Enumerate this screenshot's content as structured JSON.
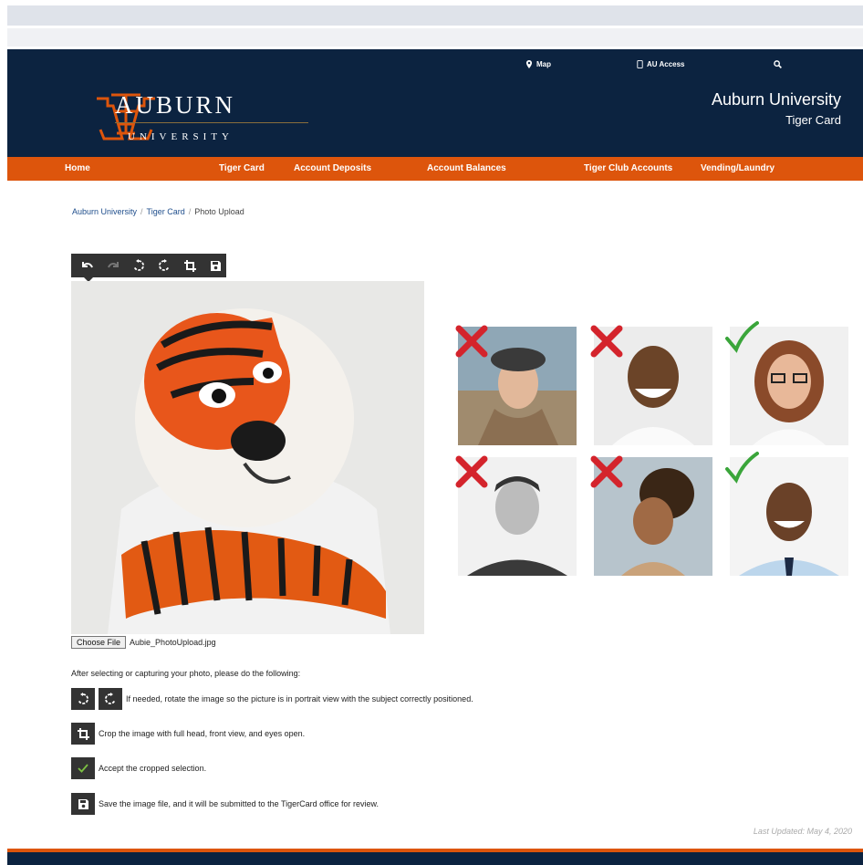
{
  "utility_links": [
    {
      "label": "Map",
      "icon": "map-pin-icon"
    },
    {
      "label": "AU Access",
      "icon": "mobile-icon"
    },
    {
      "label": "",
      "icon": "search-icon"
    }
  ],
  "logo": {
    "word": "AUBURN",
    "sub": "UNIVERSITY"
  },
  "site_title": {
    "line1": "Auburn University",
    "line2": "Tiger Card"
  },
  "nav": [
    {
      "label": "Home"
    },
    {
      "label": "Tiger Card"
    },
    {
      "label": "Account Deposits"
    },
    {
      "label": "Account Balances"
    },
    {
      "label": "Tiger Club Accounts"
    },
    {
      "label": "Vending/Laundry"
    }
  ],
  "breadcrumb": [
    {
      "label": "Auburn University"
    },
    {
      "label": "Tiger Card"
    },
    {
      "label": "Photo Upload"
    }
  ],
  "toolbar_icons": [
    "undo-icon",
    "redo-icon",
    "rotate-left-icon",
    "rotate-right-icon",
    "crop-icon",
    "save-icon"
  ],
  "file_input": {
    "button_label": "Choose File",
    "file_name": "Aubie_PhotoUpload.jpg"
  },
  "examples": [
    {
      "status": "rejected",
      "icon": "x-mark-icon"
    },
    {
      "status": "rejected",
      "icon": "x-mark-icon"
    },
    {
      "status": "accepted",
      "icon": "check-mark-icon"
    },
    {
      "status": "rejected",
      "icon": "x-mark-icon"
    },
    {
      "status": "rejected",
      "icon": "x-mark-icon"
    },
    {
      "status": "accepted",
      "icon": "check-mark-icon"
    }
  ],
  "instructions": {
    "lead": "After selecting or capturing your photo, please do the following:",
    "steps": [
      {
        "text": "If needed, rotate the image so the picture is in portrait view with the subject correctly positioned."
      },
      {
        "text": "Crop the image with full head, front view, and eyes open."
      },
      {
        "text": "Accept the cropped selection."
      },
      {
        "text": "Save the image file, and it will be submitted to the TigerCard office for review."
      }
    ]
  },
  "last_updated": "Last Updated: May 4, 2020",
  "colors": {
    "navy": "#0c2340",
    "orange": "#dd550c",
    "reject": "#d4242c",
    "accept": "#3aa53a"
  }
}
